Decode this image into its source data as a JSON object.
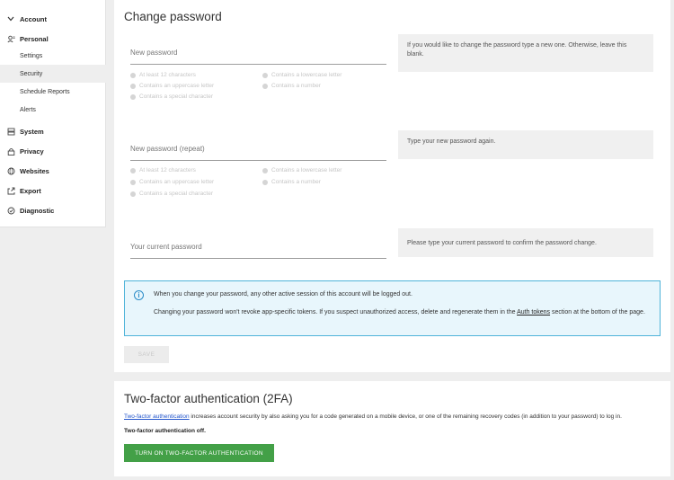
{
  "sidebar": {
    "account_label": "Account",
    "personal_label": "Personal",
    "sub_items": [
      "Settings",
      "Security",
      "Schedule Reports",
      "Alerts"
    ],
    "sections": [
      "System",
      "Privacy",
      "Websites",
      "Export",
      "Diagnostic"
    ]
  },
  "change_password": {
    "title": "Change password",
    "new_password": {
      "placeholder": "New password",
      "help": "If you would like to change the password type a new one. Otherwise, leave this blank.",
      "requirements": [
        "At least 12 characters",
        "Contains a lowercase letter",
        "Contains an uppercase letter",
        "Contains a number",
        "Contains a special character"
      ]
    },
    "repeat_password": {
      "placeholder": "New password (repeat)",
      "help": "Type your new password again.",
      "requirements": [
        "At least 12 characters",
        "Contains a lowercase letter",
        "Contains an uppercase letter",
        "Contains a number",
        "Contains a special character"
      ]
    },
    "current_password": {
      "placeholder": "Your current password",
      "help": "Please type your current password to confirm the password change."
    },
    "notice": {
      "line1": "When you change your password, any other active session of this account will be logged out.",
      "line2_before": "Changing your password won't revoke app-specific tokens. If you suspect unauthorized access, delete and regenerate them in the ",
      "line2_link": "Auth tokens",
      "line2_after": " section at the bottom of the page."
    },
    "save_label": "SAVE"
  },
  "twofa": {
    "title": "Two-factor authentication (2FA)",
    "desc_link": "Two-factor authentication",
    "desc_rest": " increases account security by also asking you for a code generated on a mobile device, or one of the remaining recovery codes (in addition to your password) to log in.",
    "status": "Two-factor authentication off.",
    "button_label": "TURN ON TWO-FACTOR AUTHENTICATION"
  }
}
